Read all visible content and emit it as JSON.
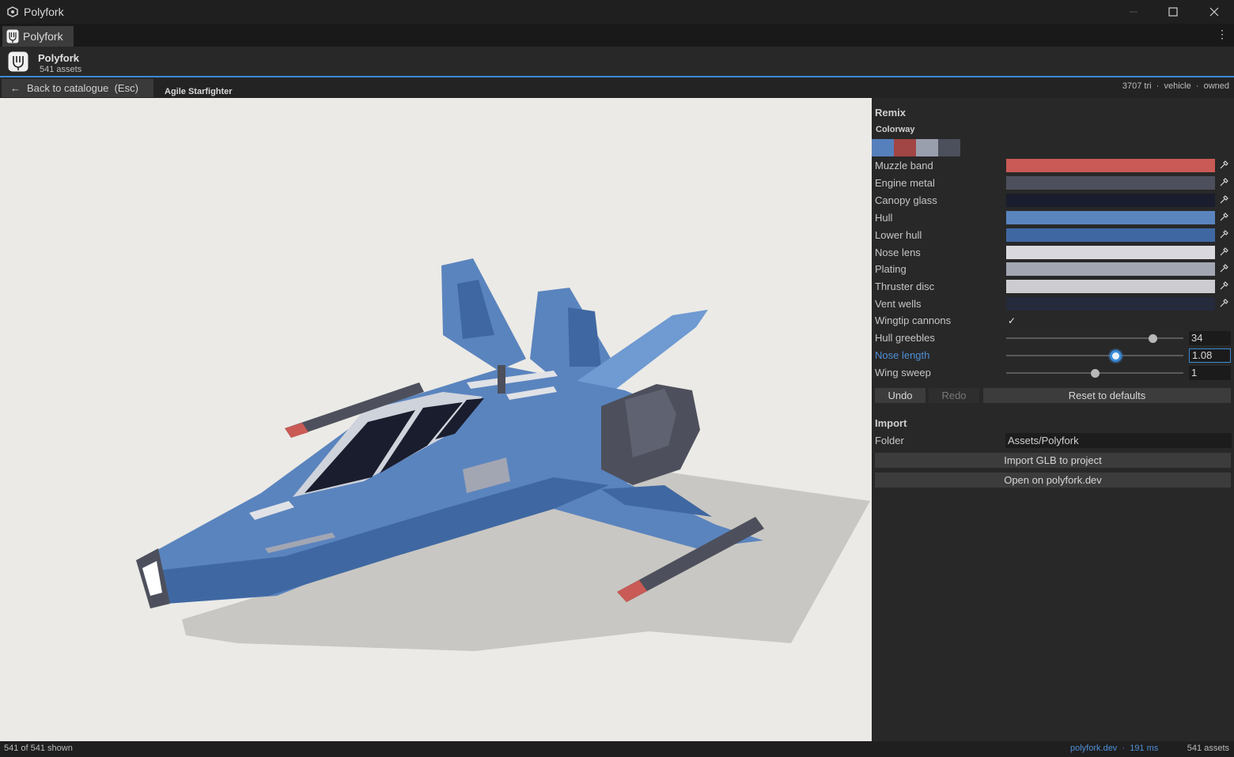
{
  "window": {
    "title": "Polyfork"
  },
  "tab": {
    "label": "Polyfork"
  },
  "header": {
    "name": "Polyfork",
    "asset_count": "541 assets"
  },
  "subbar": {
    "back_label": "Back to catalogue  (Esc)",
    "asset_name": "Agile Starfighter",
    "meta": "3707 tri  ·  vehicle  ·  owned"
  },
  "remix": {
    "title": "Remix",
    "colorway_label": "Colorway",
    "swatches": [
      "#5680bc",
      "#a24545",
      "#9a9fae",
      "#4c4f5c"
    ],
    "colors": [
      {
        "label": "Muzzle band",
        "color": "#c95a55"
      },
      {
        "label": "Engine metal",
        "color": "#4d505c"
      },
      {
        "label": "Canopy glass",
        "color": "#1a1d2d"
      },
      {
        "label": "Hull",
        "color": "#5a84be"
      },
      {
        "label": "Lower hull",
        "color": "#3f68a2"
      },
      {
        "label": "Nose lens",
        "color": "#d9d9dd"
      },
      {
        "label": "Plating",
        "color": "#a2a6b3"
      },
      {
        "label": "Thruster disc",
        "color": "#cdcdd1"
      },
      {
        "label": "Vent wells",
        "color": "#252a3c"
      }
    ],
    "wingtip": {
      "label": "Wingtip cannons",
      "checked": true
    },
    "sliders": [
      {
        "label": "Hull greebles",
        "value": "34",
        "fraction": 0.83
      },
      {
        "label": "Nose length",
        "value": "1.08",
        "fraction": 0.62,
        "active": true
      },
      {
        "label": "Wing sweep",
        "value": "1",
        "fraction": 0.5
      }
    ],
    "undo_label": "Undo",
    "redo_label": "Redo",
    "reset_label": "Reset to defaults"
  },
  "import": {
    "title": "Import",
    "folder_label": "Folder",
    "folder_value": "Assets/Polyfork",
    "import_label": "Import GLB to project",
    "open_label": "Open on polyfork.dev"
  },
  "status": {
    "shown": "541 of 541 shown",
    "link": "polyfork.dev  ·  191 ms",
    "assets": "541 assets"
  },
  "accent": "#3b8ad7"
}
